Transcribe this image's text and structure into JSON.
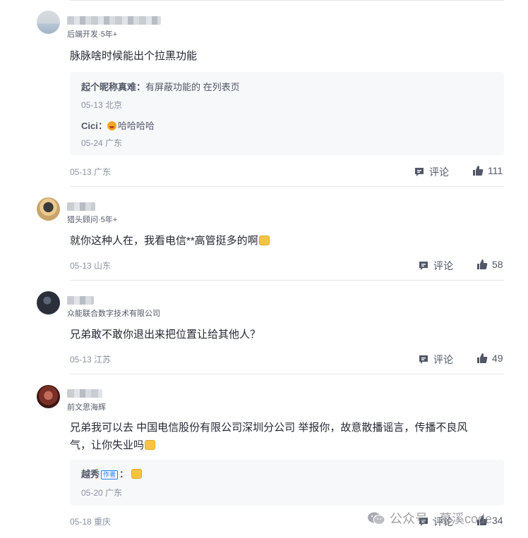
{
  "comments": [
    {
      "author_meta": "后端开发·5年+",
      "text": "脉脉啥时候能出个拉黑功能",
      "replies": [
        {
          "name": "起个昵称真难",
          "sep": "：",
          "text": "有屏蔽功能的 在列表页",
          "time": "05-13 北京"
        },
        {
          "name": "Cici",
          "sep": "：",
          "text": "哈哈哈哈",
          "time": "05-24 广东"
        }
      ],
      "time": "05-13 广东",
      "comment_label": "评论",
      "likes": "111"
    },
    {
      "author_meta": "猎头顾问·5年+",
      "text": "就你这种人在，我看电信**高管挺多的啊",
      "time": "05-13 山东",
      "comment_label": "评论",
      "likes": "58"
    },
    {
      "author_meta": "众能联合数字技术有限公司",
      "text": "兄弟敢不敢你退出来把位置让给其他人？",
      "time": "05-13 江苏",
      "comment_label": "评论",
      "likes": "49"
    },
    {
      "author_meta": "前文思海辉",
      "text_line1": "兄弟我可以去 中国电信股份有限公司深圳分公司 举报你，故意散播谣言，传播不良风",
      "text_line2": "气，让你失业吗",
      "replies": [
        {
          "name": "越秀",
          "tag": "作者",
          "sep": "：",
          "time": "05-20 广东"
        }
      ],
      "time": "05-18 重庆",
      "comment_label": "评论",
      "likes": "34"
    }
  ],
  "watermark": "公众号 · 慕溪code",
  "icons": {
    "comment": "comment-icon",
    "like": "thumbs-up-icon",
    "watermark": "wechat-icon"
  },
  "colors": {
    "text": "#252933",
    "meta": "#8a919f",
    "reply_bg": "#f7f8fa",
    "author_tag": "#1e80ff"
  }
}
